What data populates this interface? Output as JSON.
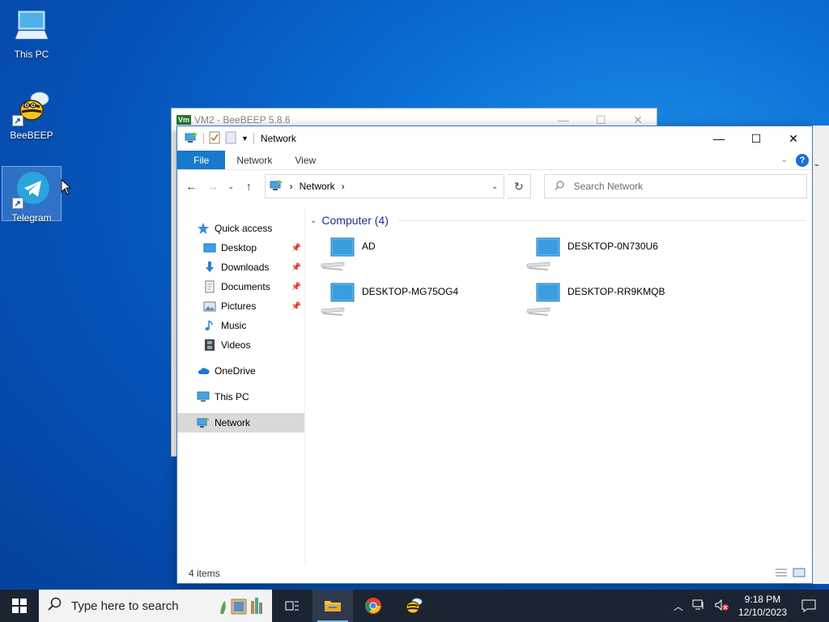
{
  "desktop": {
    "icons": [
      {
        "label": "This PC"
      },
      {
        "label": "BeeBEEP"
      },
      {
        "label": "Telegram"
      }
    ]
  },
  "background_window": {
    "badge": "Vm",
    "title": "VM2 - BeeBEEP 5.8.6"
  },
  "explorer": {
    "title": "Network",
    "ribbon_tabs": [
      "File",
      "Network",
      "View"
    ],
    "help_label": "?",
    "address": {
      "segment": "Network"
    },
    "search": {
      "placeholder": "Search Network"
    },
    "nav": {
      "quick_access": "Quick access",
      "items": [
        {
          "label": "Desktop",
          "pinned": true
        },
        {
          "label": "Downloads",
          "pinned": true
        },
        {
          "label": "Documents",
          "pinned": true
        },
        {
          "label": "Pictures",
          "pinned": true
        },
        {
          "label": "Music",
          "pinned": false
        },
        {
          "label": "Videos",
          "pinned": false
        }
      ],
      "onedrive": "OneDrive",
      "this_pc": "This PC",
      "network": "Network"
    },
    "group": {
      "label": "Computer (4)"
    },
    "computers": [
      "AD",
      "DESKTOP-0N730U6",
      "DESKTOP-MG75OG4",
      "DESKTOP-RR9KMQB"
    ],
    "status": "4 items"
  },
  "taskbar": {
    "search_placeholder": "Type here to search",
    "time": "9:18 PM",
    "date": "12/10/2023"
  },
  "colors": {
    "accent": "#1979ca",
    "taskbar": "#1b2431",
    "group_header": "#1e3287"
  }
}
